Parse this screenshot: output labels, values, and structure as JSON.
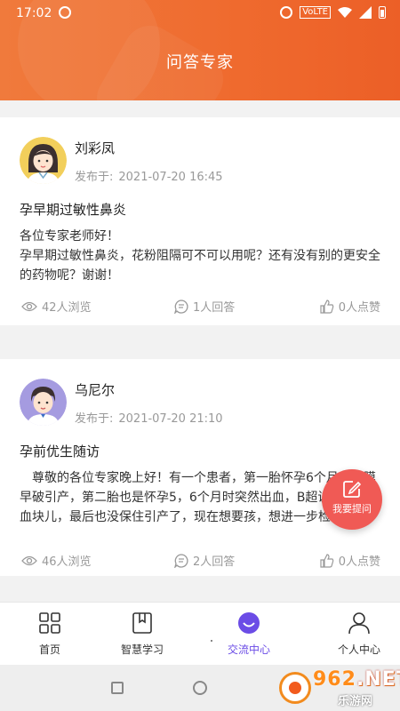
{
  "status_bar": {
    "time": "17:02",
    "network": "VoLTE"
  },
  "header": {
    "title": "问答专家"
  },
  "posts": [
    {
      "author": "刘彩凤",
      "published_label": "发布于:",
      "published_at": "2021-07-20 16:45",
      "title": "孕早期过敏性鼻炎",
      "body": [
        "各位专家老师好！",
        "孕早期过敏性鼻炎，花粉阻隔可不可以用呢？还有没有别的更安全的药物呢？谢谢！"
      ],
      "views": "42人浏览",
      "answers": "1人回答",
      "likes": "0人点赞"
    },
    {
      "author": "乌尼尔",
      "published_label": "发布于:",
      "published_at": "2021-07-20 21:10",
      "title": "孕前优生随访",
      "body": [
        "　尊敬的各位专家晚上好！有一个患者，第一胎怀孕6个月时胎膜早破引产，第二胎也是怀孕5，6个月时突然出血，B超说宫腔内有血块儿，最后也没保住引产了，现在想要孩，想进一步检查一下"
      ],
      "views": "46人浏览",
      "answers": "2人回答",
      "likes": "0人点赞"
    }
  ],
  "fab": {
    "label": "我要提问"
  },
  "tabs": [
    {
      "label": "首页",
      "icon": "home-grid-icon"
    },
    {
      "label": "智慧学习",
      "icon": "book-icon"
    },
    {
      "label": "交流中心",
      "icon": "chat-icon",
      "active": true
    },
    {
      "label": "个人中心",
      "icon": "user-icon"
    }
  ],
  "watermark": {
    "text": "962",
    "suffix": ".NET",
    "sub": "乐游网"
  },
  "colors": {
    "header": "#ef6a2e",
    "fab": "#f05a55",
    "active_tab": "#6b4ce6"
  }
}
